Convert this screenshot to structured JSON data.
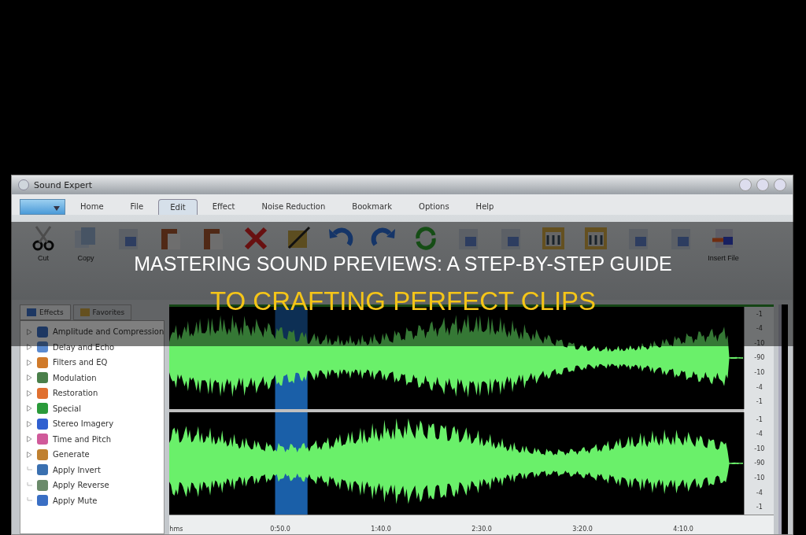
{
  "window": {
    "title": "Sound Expert"
  },
  "menu_tabs": [
    {
      "label": "Home",
      "selected": false
    },
    {
      "label": "File",
      "selected": false
    },
    {
      "label": "Edit",
      "selected": true
    },
    {
      "label": "Effect",
      "selected": false
    },
    {
      "label": "Noise Reduction",
      "selected": false
    },
    {
      "label": "Bookmark",
      "selected": false
    },
    {
      "label": "Options",
      "selected": false
    },
    {
      "label": "Help",
      "selected": false
    }
  ],
  "toolbar": [
    {
      "kind": "scissors",
      "label": "Cut"
    },
    {
      "kind": "copy",
      "label": "Copy"
    },
    {
      "kind": "doc"
    },
    {
      "kind": "paste"
    },
    {
      "kind": "paste"
    },
    {
      "kind": "delete"
    },
    {
      "kind": "crop"
    },
    {
      "kind": "undo"
    },
    {
      "kind": "redo"
    },
    {
      "kind": "refresh"
    },
    {
      "kind": "doc"
    },
    {
      "kind": "doc"
    },
    {
      "kind": "meter"
    },
    {
      "kind": "meter"
    },
    {
      "kind": "doc"
    },
    {
      "kind": "doc"
    },
    {
      "kind": "insert",
      "label": "Insert File"
    }
  ],
  "panel_tabs": [
    {
      "label": "Effects",
      "selected": true
    },
    {
      "label": "Favorites",
      "selected": false
    }
  ],
  "effects_tree": [
    {
      "label": "Amplitude and Compression",
      "kind": "group"
    },
    {
      "label": "Delay and Echo",
      "kind": "group"
    },
    {
      "label": "Filters and EQ",
      "kind": "group"
    },
    {
      "label": "Modulation",
      "kind": "group"
    },
    {
      "label": "Restoration",
      "kind": "group"
    },
    {
      "label": "Special",
      "kind": "group"
    },
    {
      "label": "Stereo Imagery",
      "kind": "group"
    },
    {
      "label": "Time and Pitch",
      "kind": "group"
    },
    {
      "label": "Generate",
      "kind": "group"
    },
    {
      "label": "Apply Invert",
      "kind": "action"
    },
    {
      "label": "Apply Reverse",
      "kind": "action"
    },
    {
      "label": "Apply Mute",
      "kind": "action"
    }
  ],
  "db_scale": [
    [
      "-1",
      "-4",
      "-10",
      "-90",
      "-10",
      "-4",
      "-1"
    ],
    [
      "-1",
      "-4",
      "-10",
      "-90",
      "-10",
      "-4",
      "-1"
    ]
  ],
  "timeline": [
    "hms",
    "0:50.0",
    "1:40.0",
    "2:30.0",
    "3:20.0",
    "4:10.0"
  ],
  "banner": {
    "line_1": "MASTERING SOUND PREVIEWS: A STEP-BY-STEP GUIDE",
    "line_2": "TO CRAFTING PERFECT CLIPS"
  }
}
